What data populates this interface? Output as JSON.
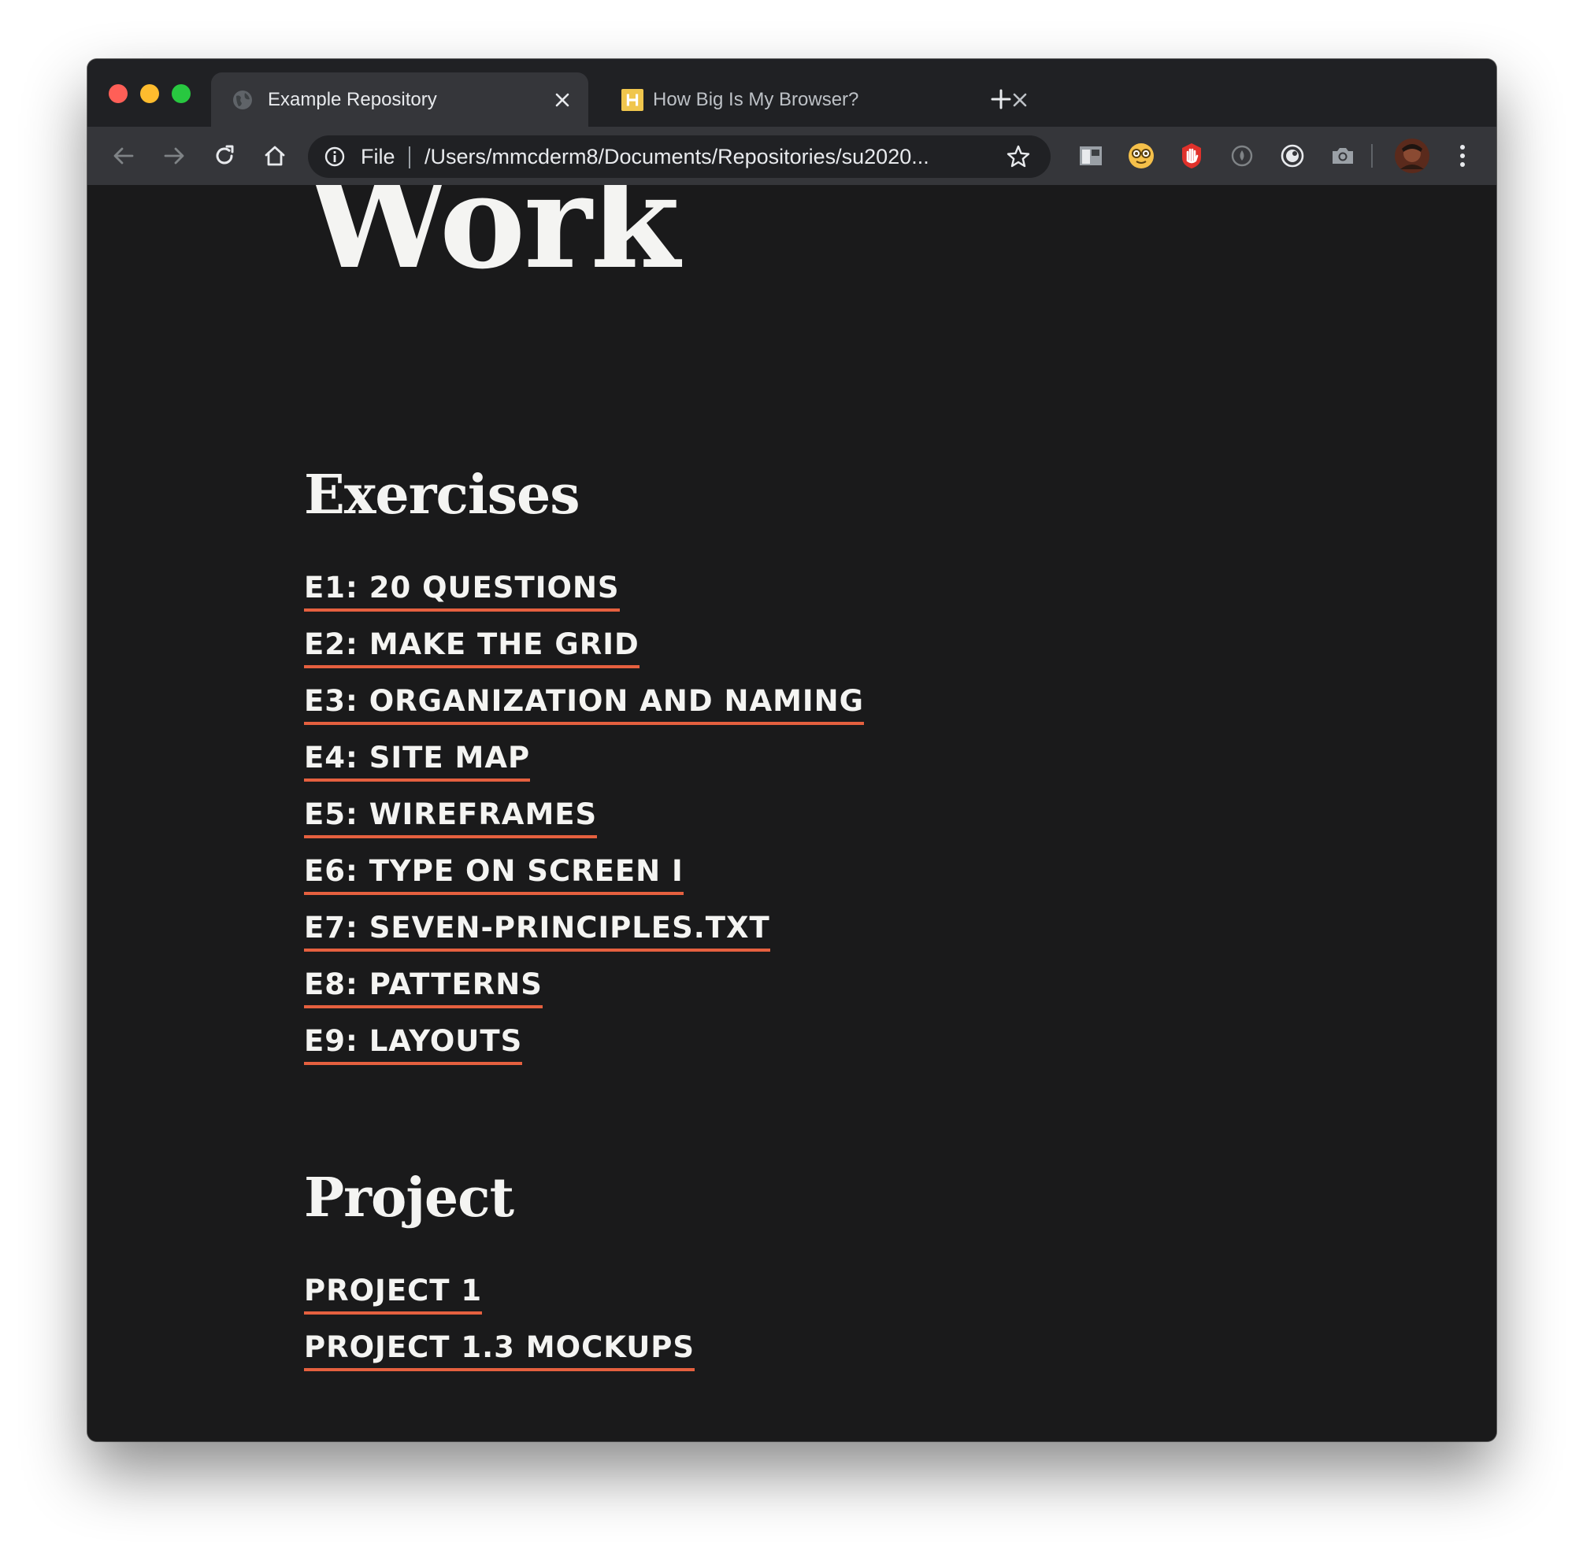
{
  "browser": {
    "tabs": [
      {
        "title": "Example Repository",
        "favicon": "globe-icon",
        "active": true
      },
      {
        "title": "How Big Is My Browser?",
        "favicon": "h-logo-icon",
        "active": false
      }
    ],
    "omnibox": {
      "scheme_label": "File",
      "url": "/Users/mmcderm8/Documents/Repositories/su2020..."
    },
    "extensions": [
      "tab-manager-icon",
      "nerd-face-icon",
      "ad-block-hand-icon",
      "drop-icon",
      "circle-icon",
      "camera-icon"
    ],
    "colors": {
      "tab_strip": "#202124",
      "toolbar": "#35363a",
      "omnibox": "#202124"
    }
  },
  "page": {
    "title": "Work",
    "sections": [
      {
        "heading": "Exercises",
        "links": [
          "E1: 20 QUESTIONS",
          "E2: MAKE THE GRID",
          "E3: ORGANIZATION AND NAMING",
          "E4: SITE MAP",
          "E5: WIREFRAMES",
          "E6: TYPE ON SCREEN I",
          "E7: SEVEN-PRINCIPLES.TXT",
          "E8: PATTERNS",
          "E9: LAYOUTS"
        ]
      },
      {
        "heading": "Project",
        "links": [
          "PROJECT 1",
          "PROJECT 1.3 MOCKUPS"
        ]
      }
    ],
    "colors": {
      "background": "#1a1a1b",
      "text": "#f4f4f2",
      "link_underline": "#e5603f"
    }
  }
}
